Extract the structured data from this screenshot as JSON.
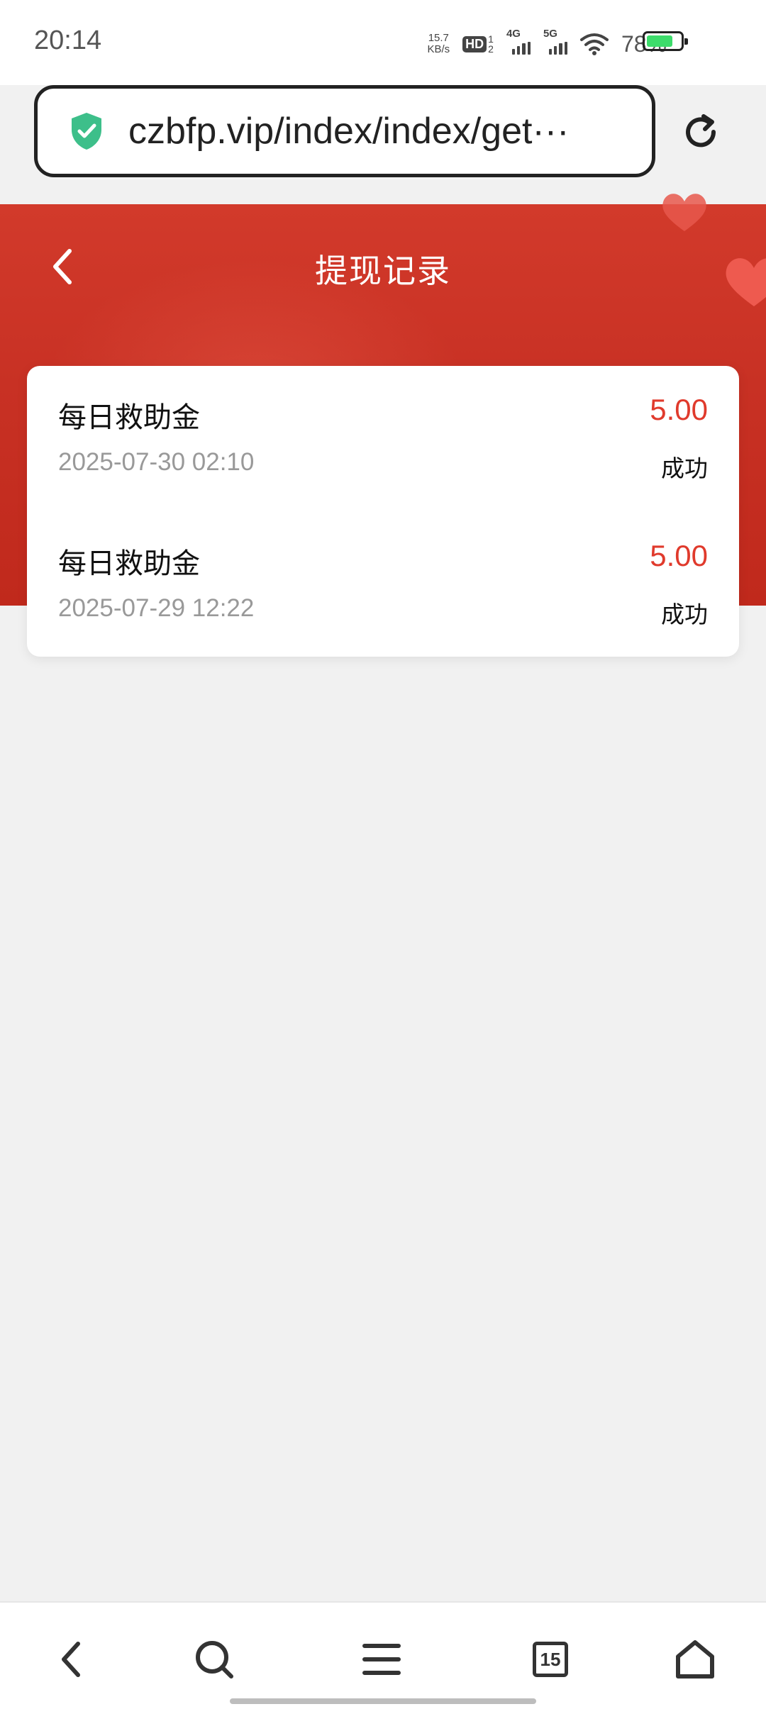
{
  "status_bar": {
    "time": "20:14",
    "net_speed_value": "15.7",
    "net_speed_unit": "KB/s",
    "hd_label": "HD",
    "hd_sub": "1\n2",
    "sig1_label": "4G",
    "sig2_label": "5G",
    "battery_percent": "78%",
    "battery_level": 0.78
  },
  "browser": {
    "url": "czbfp.vip/index/index/get···",
    "secure_icon": "shield-check-icon",
    "reload_icon": "reload-icon"
  },
  "page": {
    "title": "提现记录",
    "back_icon": "chevron-left-icon"
  },
  "records": [
    {
      "title": "每日救助金",
      "amount": "5.00",
      "date": "2025-07-30 02:10",
      "status": "成功"
    },
    {
      "title": "每日救助金",
      "amount": "5.00",
      "date": "2025-07-29 12:22",
      "status": "成功"
    }
  ],
  "bottom_nav": {
    "tab_count": "15",
    "items": [
      "back-icon",
      "search-icon",
      "menu-icon",
      "tabs-icon",
      "home-icon"
    ]
  },
  "colors": {
    "banner": "#c8301f",
    "amount": "#e03a2c",
    "shield": "#3dbf8a",
    "battery": "#3ddc6b"
  }
}
